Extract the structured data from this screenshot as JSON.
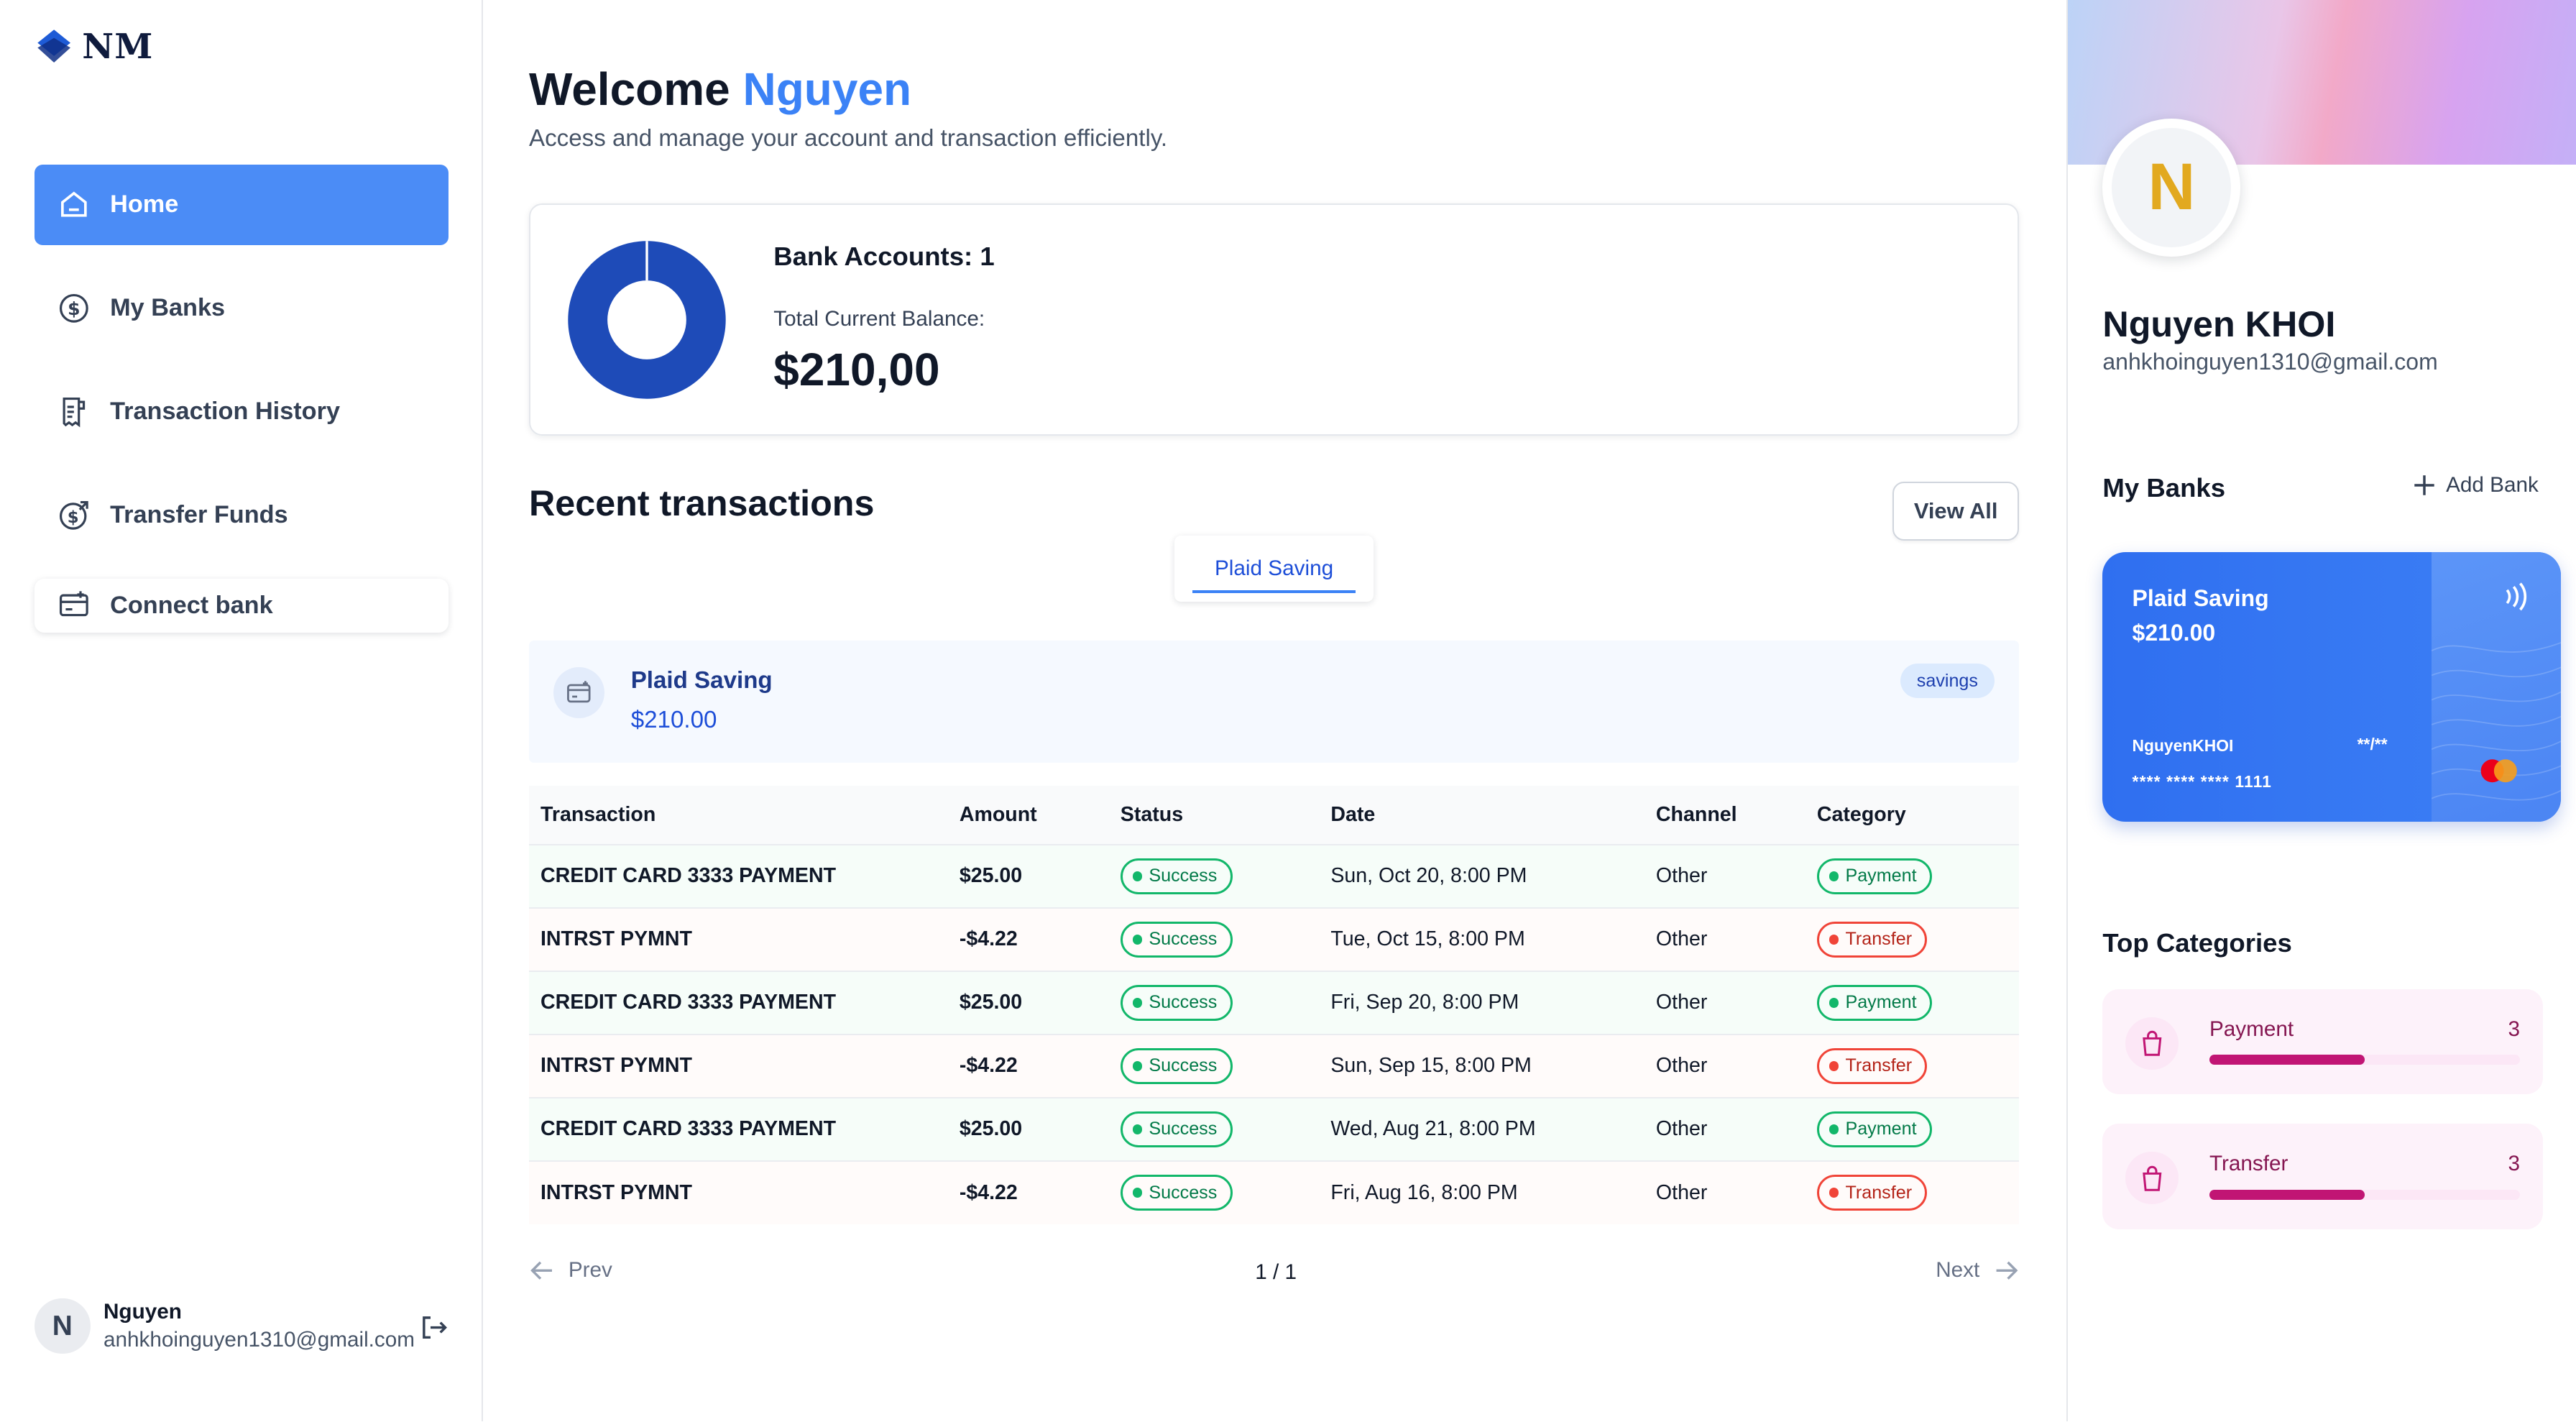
{
  "sidebar": {
    "logo_text": "NM",
    "nav": [
      {
        "label": "Home",
        "icon": "home-icon",
        "active": true
      },
      {
        "label": "My Banks",
        "icon": "dollar-circle-icon",
        "active": false
      },
      {
        "label": "Transaction History",
        "icon": "receipt-icon",
        "active": false
      },
      {
        "label": "Transfer Funds",
        "icon": "money-send-icon",
        "active": false
      },
      {
        "label": "Connect bank",
        "icon": "card-add-icon",
        "active": false
      }
    ],
    "user": {
      "initial": "N",
      "name": "Nguyen",
      "email": "anhkhoinguyen1310@gmail.com"
    }
  },
  "header": {
    "welcome": "Welcome",
    "name": "Nguyen",
    "subtitle": "Access and manage your account and transaction efficiently."
  },
  "balance": {
    "bank_accounts": "Bank Accounts: 1",
    "total_label": "Total Current Balance:",
    "total_value": "$210,00"
  },
  "recent": {
    "title": "Recent transactions",
    "view_all": "View All",
    "tab": "Plaid Saving",
    "account": {
      "name": "Plaid Saving",
      "balance": "$210.00",
      "type": "savings"
    },
    "columns": [
      "Transaction",
      "Amount",
      "Status",
      "Date",
      "Channel",
      "Category"
    ],
    "rows": [
      {
        "name": "CREDIT CARD 3333 PAYMENT",
        "amount": "$25.00",
        "sign": "pos",
        "status": "Success",
        "date": "Sun, Oct 20, 8:00 PM",
        "channel": "Other",
        "category": "Payment"
      },
      {
        "name": "INTRST PYMNT",
        "amount": "-$4.22",
        "sign": "neg",
        "status": "Success",
        "date": "Tue, Oct 15, 8:00 PM",
        "channel": "Other",
        "category": "Transfer"
      },
      {
        "name": "CREDIT CARD 3333 PAYMENT",
        "amount": "$25.00",
        "sign": "pos",
        "status": "Success",
        "date": "Fri, Sep 20, 8:00 PM",
        "channel": "Other",
        "category": "Payment"
      },
      {
        "name": "INTRST PYMNT",
        "amount": "-$4.22",
        "sign": "neg",
        "status": "Success",
        "date": "Sun, Sep 15, 8:00 PM",
        "channel": "Other",
        "category": "Transfer"
      },
      {
        "name": "CREDIT CARD 3333 PAYMENT",
        "amount": "$25.00",
        "sign": "pos",
        "status": "Success",
        "date": "Wed, Aug 21, 8:00 PM",
        "channel": "Other",
        "category": "Payment"
      },
      {
        "name": "INTRST PYMNT",
        "amount": "-$4.22",
        "sign": "neg",
        "status": "Success",
        "date": "Fri, Aug 16, 8:00 PM",
        "channel": "Other",
        "category": "Transfer"
      }
    ],
    "pagination": {
      "prev": "Prev",
      "page": "1 / 1",
      "next": "Next"
    }
  },
  "profile": {
    "initial": "N",
    "name": "Nguyen KHOI",
    "email": "anhkhoinguyen1310@gmail.com"
  },
  "my_banks": {
    "title": "My Banks",
    "add_label": "Add Bank",
    "card": {
      "name": "Plaid Saving",
      "balance": "$210.00",
      "holder": "NguyenKHOI",
      "expiry": "**/**",
      "number": "**** **** **** 1111"
    }
  },
  "top_categories": {
    "title": "Top Categories",
    "items": [
      {
        "name": "Payment",
        "count": "3",
        "progress": 0.5
      },
      {
        "name": "Transfer",
        "count": "3",
        "progress": 0.5
      }
    ]
  },
  "colors": {
    "accent": "#4b8cf6",
    "success": "#12b76a",
    "danger": "#f04438",
    "category": "#c11574"
  }
}
